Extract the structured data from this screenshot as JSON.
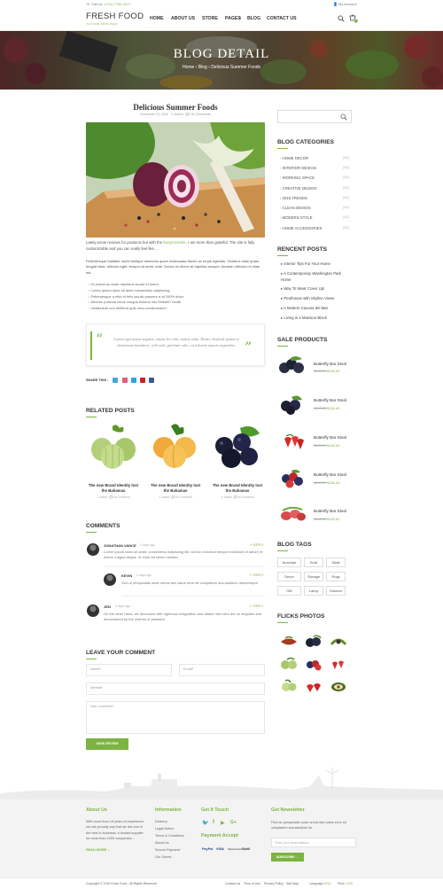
{
  "topbar": {
    "phone": "Call us:",
    "phone_number": "(+01) 7784 4477",
    "account": "My Account"
  },
  "header": {
    "logo": "FRESH FOOD",
    "logo_tagline": "NATURE PROVIDED",
    "nav": [
      "HOME",
      "ABOUT US",
      "STORE",
      "PAGES",
      "BLOG",
      "CONTACT US"
    ],
    "cart_count": "0"
  },
  "hero": {
    "title": "BLOG DETAIL",
    "crumbs": [
      "Home",
      "Blog",
      "Delicious Summer Foods"
    ]
  },
  "post": {
    "title": "Delicious Summer Foods",
    "date": "December 20, 2016",
    "author": "Admin",
    "comments": "06 Comments",
    "intro": "Lately wrote reviews for products but with the",
    "intro_link": "EasyCovertie,",
    "intro_rest": " I am more than grateful. The site is fully customizable and you can really feel like ...",
    "body": "Pellentesque habitant morbi tristique senectus quam malesuada fames ac turpis egestas. Vivamus vitae quam, feugiat vitae, ultricies eget, tempor sit amet, ante. Donec eu libero sit egestas semper. Aenean ultricies mi vitae est.",
    "bullets": [
      "Ut pharet ac dude maximus scudo et lorem",
      "Lorem ipsum dolor sit amet consectetur adipiscing",
      "Pellentesque a nibh id felis iaculis posuere a at 200% dolor",
      "Aenean pulvinar lacus congue fluiteus nisl Stobelli7 bludti",
      "Vestibulum non eleifend quis urna condimentum"
    ],
    "quote": "Lorem eget ipsum sagittis, vasius leo velit, mattis enim. Donec eleifend, ipsum et elementum hendrerit, velit velit, pulvinar odio, eu lobortis mauris imperdiet.",
    "share_label": "SHARE THIS :"
  },
  "related": {
    "heading": "RELATED POSTS",
    "items": [
      {
        "title": "The new Brand Identity lost the Bahamas",
        "author": "Admin",
        "comments": "06 Comment"
      },
      {
        "title": "The new Brand Identity lost the Bahamas",
        "author": "Admin",
        "comments": "06 Comment"
      },
      {
        "title": "The new Brand Identity lost the Bahamas",
        "author": "Admin",
        "comments": "06 Comment"
      }
    ]
  },
  "comments": {
    "heading": "COMMENTS",
    "reply": "REPLY",
    "items": [
      {
        "name": "JONATHAN VANCE",
        "date": "2 days ago",
        "text": "Lorem ipsum dolor sit amet, consectetur adipiscing elit, sed do eiusmod tempor incididunt ut labore et dolore magna aliqua. Ut enim ad minim veniam."
      },
      {
        "name": "KEVIN",
        "date": "2 days ago",
        "text": "Sed ut perspiciatis unde omnis iste natus error sit voluptatem accusantium doloremque."
      },
      {
        "name": "JEN",
        "date": "2 days ago",
        "text": "On the other hand, we denounce with righteous indignation and dislike men who are so beguiled and demoralized by the charms of pleasure."
      }
    ]
  },
  "form": {
    "heading": "LEAVE YOUR COMMENT",
    "name": "Name",
    "email": "Email",
    "website": "Website",
    "comment": "Your comment",
    "submit": "SEND REVIEW"
  },
  "sidebar": {
    "categories_heading": "BLOG CATEGORIES",
    "categories": [
      {
        "name": "HOME DECOR",
        "count": "(10)"
      },
      {
        "name": "INTERIOR DESIGN",
        "count": "(10)"
      },
      {
        "name": "WORKING SPACE",
        "count": "(10)"
      },
      {
        "name": "CREATIVE DESIGN",
        "count": "(10)"
      },
      {
        "name": "2016 TRENDS",
        "count": "(10)"
      },
      {
        "name": "CLEAN DESIGN",
        "count": "(10)"
      },
      {
        "name": "MODERN STYLE",
        "count": "(10)"
      },
      {
        "name": "HOME ACCESSORIES",
        "count": "(10)"
      }
    ],
    "recent_heading": "RENCENT POSTS",
    "recent": [
      "Interior Tips For Your Home",
      "A Contemporary Washington Park Home",
      "Way To Wear Cover Up!",
      "Penthouse with Skyline Views",
      "A Modern Casona del Mar",
      "Living in a Mansion Block"
    ],
    "sale_heading": "SALE PRODUCTS",
    "products": [
      {
        "name": "Butterfly Bar Stool",
        "old": "$198.00",
        "new": "$150.00"
      },
      {
        "name": "Butterfly Bar Stool",
        "old": "$198.00",
        "new": "$150.00"
      },
      {
        "name": "Butterfly Bar Stool",
        "old": "$198.00",
        "new": "$150.00"
      },
      {
        "name": "Butterfly Bar Stool",
        "old": "$198.00",
        "new": "$150.00"
      },
      {
        "name": "Butterfly Bar Stool",
        "old": "$198.00",
        "new": "$150.00"
      }
    ],
    "tags_heading": "BLOG TAGS",
    "tags": [
      "Armchair",
      "Sofa",
      "Table",
      "Decor",
      "Storage",
      "Rugs",
      "Gift",
      "Lamp",
      "Outdoor"
    ],
    "flicks_heading": "FLICKS PHOTOS"
  },
  "footer": {
    "about_heading": "About Us",
    "about_text": "With more than 15 years of experience we can proudly say that we are one of the best in business, a trusted supplier for more than 1000 companies...",
    "read_more": "READ MORE",
    "info_heading": "Information",
    "info_links": [
      "Delivery",
      "Legal Notice",
      "Terms & Conditions",
      "About Us",
      "Secure Payment",
      "Our Stores"
    ],
    "touch_heading": "Get It Touch",
    "payment_heading": "Payment Accept",
    "payments": [
      "PayPal",
      "VISA",
      "MasterCard",
      "Skrill"
    ],
    "newsletter_heading": "Get Newsletter",
    "newsletter_text": "Find an perspiciatis unde omnis iste natus error sit voluptatem accusantium do.",
    "newsletter_placeholder": "Enter your email address",
    "subscribe": "SUBSCRIBE",
    "copyright": "Copyright © 2016 Fresh Food - All Rights Reserved",
    "bottom_links": [
      "Contact Us",
      "Term of Use",
      "Privacy Policy",
      "Site Map"
    ],
    "language_label": "Language:",
    "language": "ENG",
    "price_label": "Price:",
    "price": "USD"
  },
  "colors": {
    "accent": "#7cb342",
    "text": "#333333",
    "footer_bg": "#f3f3f3"
  }
}
